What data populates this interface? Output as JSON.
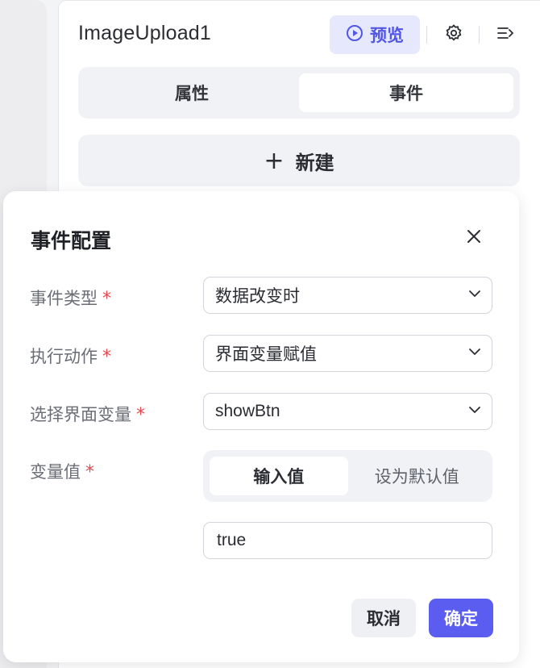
{
  "panel": {
    "component_name": "ImageUpload1",
    "preview_label": "预览",
    "tabs": [
      {
        "label": "属性",
        "active": false
      },
      {
        "label": "事件",
        "active": true
      }
    ],
    "new_plus": "+",
    "new_label": "新建"
  },
  "dialog": {
    "title": "事件配置",
    "fields": {
      "event_type": {
        "label": "事件类型",
        "required": "*",
        "value": "数据改变时"
      },
      "action": {
        "label": "执行动作",
        "required": "*",
        "value": "界面变量赋值"
      },
      "variable": {
        "label": "选择界面变量",
        "required": "*",
        "value": "showBtn"
      },
      "var_value": {
        "label": "变量值",
        "required": "*",
        "options": [
          "输入值",
          "设为默认值"
        ],
        "selected": "输入值",
        "input_value": "true"
      }
    },
    "cancel_label": "取消",
    "ok_label": "确定"
  },
  "colors": {
    "accent": "#5b5cf0",
    "accent_soft": "#e6e8fd",
    "required": "#e5484d"
  },
  "icons": [
    "play-circle-icon",
    "gear-icon",
    "collapse-panel-icon",
    "close-icon",
    "chevron-down-icon"
  ]
}
